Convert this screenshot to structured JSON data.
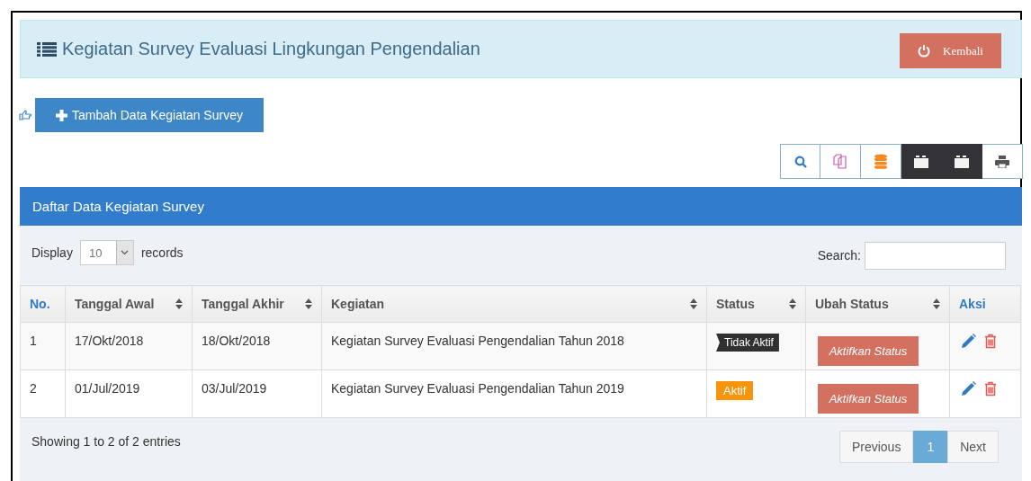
{
  "header": {
    "title": "Kegiatan Survey Evaluasi Lingkungan Pengendalian",
    "back_button": "Kembali"
  },
  "add_button": "Tambah Data Kegiatan Survey",
  "tools": [
    {
      "kind": "search",
      "selected": false
    },
    {
      "kind": "copy",
      "selected": false
    },
    {
      "kind": "database",
      "selected": false
    },
    {
      "kind": "folder",
      "selected": true
    },
    {
      "kind": "folder",
      "selected": true
    },
    {
      "kind": "print",
      "selected": false
    }
  ],
  "panel": {
    "title": "Daftar Data Kegiatan Survey"
  },
  "length": {
    "label_before": "Display",
    "value": "10",
    "label_after": "records"
  },
  "search": {
    "label": "Search:"
  },
  "table": {
    "columns": [
      {
        "label": "No.",
        "sortable": false
      },
      {
        "label": "Tanggal Awal",
        "sortable": true
      },
      {
        "label": "Tanggal Akhir",
        "sortable": true
      },
      {
        "label": "Kegiatan",
        "sortable": true
      },
      {
        "label": "Status",
        "sortable": true
      },
      {
        "label": "Ubah Status",
        "sortable": true
      },
      {
        "label": "Aksi",
        "sortable": false
      }
    ],
    "rows": [
      {
        "no": "1",
        "start": "17/Okt/2018",
        "end": "18/Okt/2018",
        "activity": "Kegiatan Survey Evaluasi Pengendalian Tahun 2018",
        "status": {
          "label": "Tidak Aktif",
          "kind": "inactive"
        },
        "action": "Aktifkan Status"
      },
      {
        "no": "2",
        "start": "01/Jul/2019",
        "end": "03/Jul/2019",
        "activity": "Kegiatan Survey Evaluasi Pengendalian Tahun 2019",
        "status": {
          "label": "Aktif",
          "kind": "active"
        },
        "action": "Aktifkan Status"
      }
    ]
  },
  "info": "Showing 1 to 2 of 2 entries",
  "pagination": {
    "previous": "Previous",
    "pages": [
      {
        "label": "1",
        "selected": true
      }
    ],
    "next": "Next"
  }
}
